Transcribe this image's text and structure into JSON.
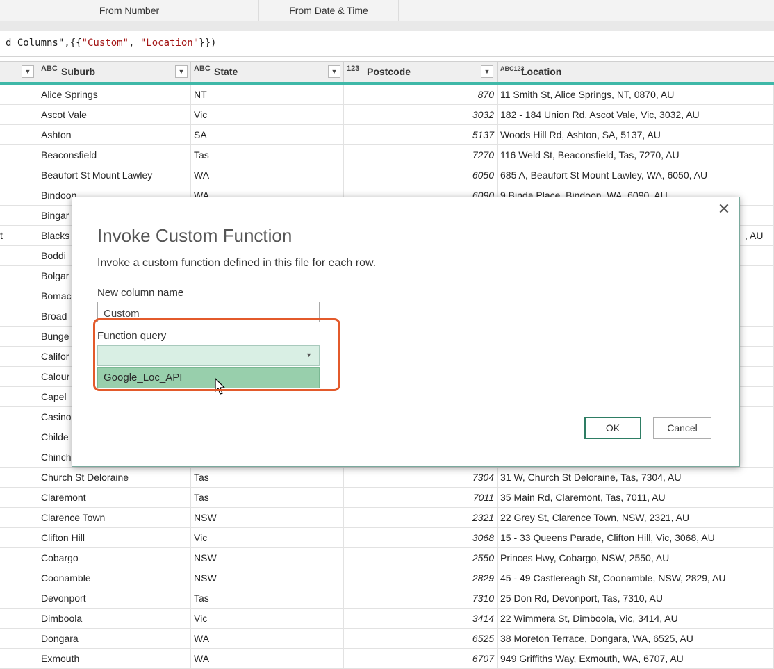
{
  "ribbon": {
    "from_number_label": "From Number",
    "from_date_time_label": "From Date & Time"
  },
  "formula_bar": {
    "prefix": "d Columns\",{{",
    "str1": "\"Custom\"",
    "sep": ", ",
    "str2": "\"Location\"",
    "suffix": "}})"
  },
  "columns": [
    {
      "type_icon": "ABC",
      "name": "Suburb"
    },
    {
      "type_icon": "ABC",
      "name": "State"
    },
    {
      "type_icon": "123",
      "name": "Postcode"
    },
    {
      "type_icon": "ABC123",
      "name": "Location"
    }
  ],
  "rows": [
    {
      "left": "",
      "suburb": "Alice Springs",
      "state": "NT",
      "postcode": "870",
      "location": "11 Smith St, Alice Springs, NT, 0870, AU"
    },
    {
      "left": "",
      "suburb": "Ascot Vale",
      "state": "Vic",
      "postcode": "3032",
      "location": "182 - 184 Union Rd, Ascot Vale, Vic, 3032, AU"
    },
    {
      "left": "",
      "suburb": "Ashton",
      "state": "SA",
      "postcode": "5137",
      "location": "Woods Hill Rd, Ashton, SA, 5137, AU"
    },
    {
      "left": "",
      "suburb": "Beaconsfield",
      "state": "Tas",
      "postcode": "7270",
      "location": "116 Weld St, Beaconsfield, Tas, 7270, AU"
    },
    {
      "left": "",
      "suburb": "Beaufort St  Mount Lawley",
      "state": "WA",
      "postcode": "6050",
      "location": "685 A, Beaufort St  Mount Lawley, WA, 6050, AU"
    },
    {
      "left": "",
      "suburb": "Bindoon",
      "state": "WA",
      "postcode": "6090",
      "location": "9 Binda Place, Bindoon, WA, 6090, AU"
    },
    {
      "left": "",
      "suburb": "Bingar",
      "state": "",
      "postcode": "",
      "location": ""
    },
    {
      "left": "t",
      "suburb": "Blacks",
      "state": "",
      "postcode": "",
      "location": ", AU"
    },
    {
      "left": "",
      "suburb": "Boddi",
      "state": "",
      "postcode": "",
      "location": ""
    },
    {
      "left": "",
      "suburb": "Bolgar",
      "state": "",
      "postcode": "",
      "location": ""
    },
    {
      "left": "",
      "suburb": "Bomac",
      "state": "",
      "postcode": "",
      "location": ""
    },
    {
      "left": "",
      "suburb": "Broad",
      "state": "",
      "postcode": "",
      "location": ""
    },
    {
      "left": "",
      "suburb": "Bunge",
      "state": "",
      "postcode": "",
      "location": ""
    },
    {
      "left": "",
      "suburb": "Califor",
      "state": "",
      "postcode": "",
      "location": ""
    },
    {
      "left": "",
      "suburb": "Calour",
      "state": "",
      "postcode": "",
      "location": ""
    },
    {
      "left": "",
      "suburb": "Capel",
      "state": "",
      "postcode": "",
      "location": ""
    },
    {
      "left": "",
      "suburb": "Casino",
      "state": "",
      "postcode": "",
      "location": ""
    },
    {
      "left": "",
      "suburb": "Childe",
      "state": "",
      "postcode": "",
      "location": ""
    },
    {
      "left": "",
      "suburb": "Chinch",
      "state": "",
      "postcode": "",
      "location": ""
    },
    {
      "left": "",
      "suburb": "Church St  Deloraine",
      "state": "Tas",
      "postcode": "7304",
      "location": "31 W, Church St  Deloraine, Tas, 7304, AU"
    },
    {
      "left": "",
      "suburb": "Claremont",
      "state": "Tas",
      "postcode": "7011",
      "location": "35 Main Rd, Claremont, Tas, 7011, AU"
    },
    {
      "left": "",
      "suburb": "Clarence Town",
      "state": "NSW",
      "postcode": "2321",
      "location": "22 Grey St, Clarence Town, NSW, 2321, AU"
    },
    {
      "left": "",
      "suburb": "Clifton Hill",
      "state": "Vic",
      "postcode": "3068",
      "location": "15 - 33 Queens Parade, Clifton Hill, Vic, 3068, AU"
    },
    {
      "left": "",
      "suburb": "Cobargo",
      "state": "NSW",
      "postcode": "2550",
      "location": "Princes Hwy, Cobargo, NSW, 2550, AU"
    },
    {
      "left": "",
      "suburb": "Coonamble",
      "state": "NSW",
      "postcode": "2829",
      "location": "45 - 49 Castlereagh St, Coonamble, NSW, 2829, AU"
    },
    {
      "left": "",
      "suburb": "Devonport",
      "state": "Tas",
      "postcode": "7310",
      "location": "25 Don Rd, Devonport, Tas, 7310, AU"
    },
    {
      "left": "",
      "suburb": "Dimboola",
      "state": "Vic",
      "postcode": "3414",
      "location": "22 Wimmera St, Dimboola, Vic, 3414, AU"
    },
    {
      "left": "",
      "suburb": "Dongara",
      "state": "WA",
      "postcode": "6525",
      "location": "38 Moreton Terrace, Dongara, WA, 6525, AU"
    },
    {
      "left": "",
      "suburb": "Exmouth",
      "state": "WA",
      "postcode": "6707",
      "location": "949 Griffiths Way, Exmouth, WA, 6707, AU"
    }
  ],
  "dialog": {
    "title": "Invoke Custom Function",
    "description": "Invoke a custom function defined in this file for each row.",
    "new_column_label": "New column name",
    "new_column_value": "Custom",
    "function_query_label": "Function query",
    "function_query_value": "",
    "dropdown_option": "Google_Loc_API",
    "ok_label": "OK",
    "cancel_label": "Cancel",
    "close_icon": "close-icon"
  },
  "colors": {
    "accent": "#3fb8a8",
    "highlight": "#e35a2b",
    "dropdown_bg": "#d9efe4",
    "option_bg": "#98cfac"
  }
}
